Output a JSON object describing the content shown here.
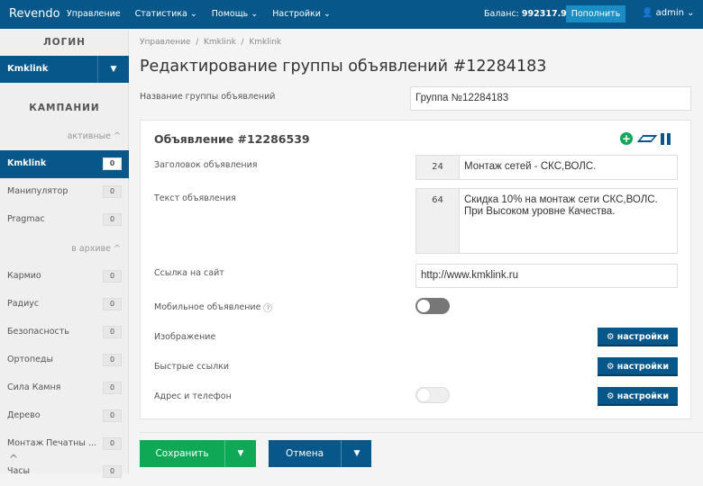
{
  "topbar": {
    "brand": "Revendo",
    "nav": [
      "Управление",
      "Статистика ⌄",
      "Помощь ⌄",
      "Настройки ⌄"
    ],
    "balance_label": "Баланс:",
    "balance_value": "992317.9 ₽",
    "topup": "Пополнить",
    "user": "admin"
  },
  "sidebar": {
    "login_heading": "ЛОГИН",
    "login_value": "Kmklink",
    "campaigns_heading": "КАМПАНИИ",
    "active_label": "активные ^",
    "archive_label": "в архиве ^",
    "active": [
      {
        "name": "Kmklink",
        "count": "0"
      },
      {
        "name": "Манипулятор",
        "count": "0"
      },
      {
        "name": "Pragmac",
        "count": "0"
      }
    ],
    "archive": [
      {
        "name": "Кармио",
        "count": "0"
      },
      {
        "name": "Радиус",
        "count": "0"
      },
      {
        "name": "Безопасность",
        "count": "0"
      },
      {
        "name": "Ортопеды",
        "count": "0"
      },
      {
        "name": "Сила Камня",
        "count": "0"
      },
      {
        "name": "Дерево",
        "count": "0"
      },
      {
        "name": "Монтаж Печатны ...",
        "count": "0"
      },
      {
        "name": "Часы",
        "count": "0"
      }
    ]
  },
  "breadcrumb": [
    "Управление",
    "/",
    "Kmklink",
    "/",
    "Kmklink"
  ],
  "page_title": "Редактирование группы объявлений #12284183",
  "group_name_label": "Название группы объявлений",
  "group_name_value": "Группа №12284183",
  "ad": {
    "title": "Объявление #12286539",
    "headline_label": "Заголовок объявления",
    "headline_count": "24",
    "headline_value": "Монтаж сетей - СКС,ВОЛС.",
    "text_label": "Текст объявления",
    "text_count": "64",
    "text_value": "Скидка 10% на монтаж сети СКС,ВОЛС. При Высоком уровне Качества.",
    "url_label": "Ссылка на сайт",
    "url_value": "http://www.kmklink.ru",
    "mobile_label": "Мобильное объявление",
    "help": "?",
    "image_label": "Изображение",
    "quicklinks_label": "Быстрые ссылки",
    "address_label": "Адрес и телефон",
    "settings": "⚙ настройки"
  },
  "actions": {
    "save": "Сохранить",
    "cancel": "Отмена"
  },
  "colors": {
    "primary": "#07578a",
    "success": "#0ea856"
  }
}
